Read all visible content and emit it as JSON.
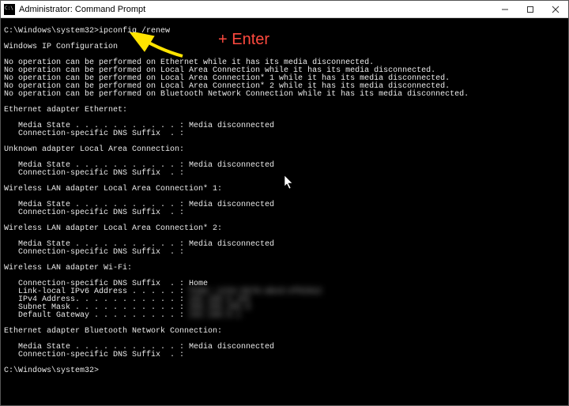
{
  "window": {
    "title": "Administrator: Command Prompt"
  },
  "command": {
    "prompt1": "C:\\Windows\\system32>",
    "cmd1": "ipconfig /renew",
    "prompt2": "C:\\Windows\\system32>"
  },
  "heading": "Windows IP Configuration",
  "errors": [
    "No operation can be performed on Ethernet while it has its media disconnected.",
    "No operation can be performed on Local Area Connection while it has its media disconnected.",
    "No operation can be performed on Local Area Connection* 1 while it has its media disconnected.",
    "No operation can be performed on Local Area Connection* 2 while it has its media disconnected.",
    "No operation can be performed on Bluetooth Network Connection while it has its media disconnected."
  ],
  "sections": [
    {
      "title": "Ethernet adapter Ethernet:",
      "lines": [
        "   Media State . . . . . . . . . . . : Media disconnected",
        "   Connection-specific DNS Suffix  . :"
      ]
    },
    {
      "title": "Unknown adapter Local Area Connection:",
      "lines": [
        "   Media State . . . . . . . . . . . : Media disconnected",
        "   Connection-specific DNS Suffix  . :"
      ]
    },
    {
      "title": "Wireless LAN adapter Local Area Connection* 1:",
      "lines": [
        "   Media State . . . . . . . . . . . : Media disconnected",
        "   Connection-specific DNS Suffix  . :"
      ]
    },
    {
      "title": "Wireless LAN adapter Local Area Connection* 2:",
      "lines": [
        "   Media State . . . . . . . . . . . : Media disconnected",
        "   Connection-specific DNS Suffix  . :"
      ]
    }
  ],
  "wifi": {
    "title": "Wireless LAN adapter Wi-Fi:",
    "dns_suffix_label": "   Connection-specific DNS Suffix  . : ",
    "dns_suffix_value": "Home",
    "ipv6_label": "   Link-local IPv6 Address . . . . . : ",
    "ipv6_value": "fe80::1234:5678:abcd:ef01%12",
    "ipv4_label": "   IPv4 Address. . . . . . . . . . . : ",
    "ipv4_value": "192.168.0.102",
    "mask_label": "   Subnet Mask . . . . . . . . . . . : ",
    "mask_value": "255.255.255.0",
    "gw_label": "   Default Gateway . . . . . . . . . : ",
    "gw_value": "192.168.0.1"
  },
  "bt": {
    "title": "Ethernet adapter Bluetooth Network Connection:",
    "lines": [
      "   Media State . . . . . . . . . . . : Media disconnected",
      "   Connection-specific DNS Suffix  . :"
    ]
  },
  "annotation": {
    "text": "+ Enter"
  }
}
